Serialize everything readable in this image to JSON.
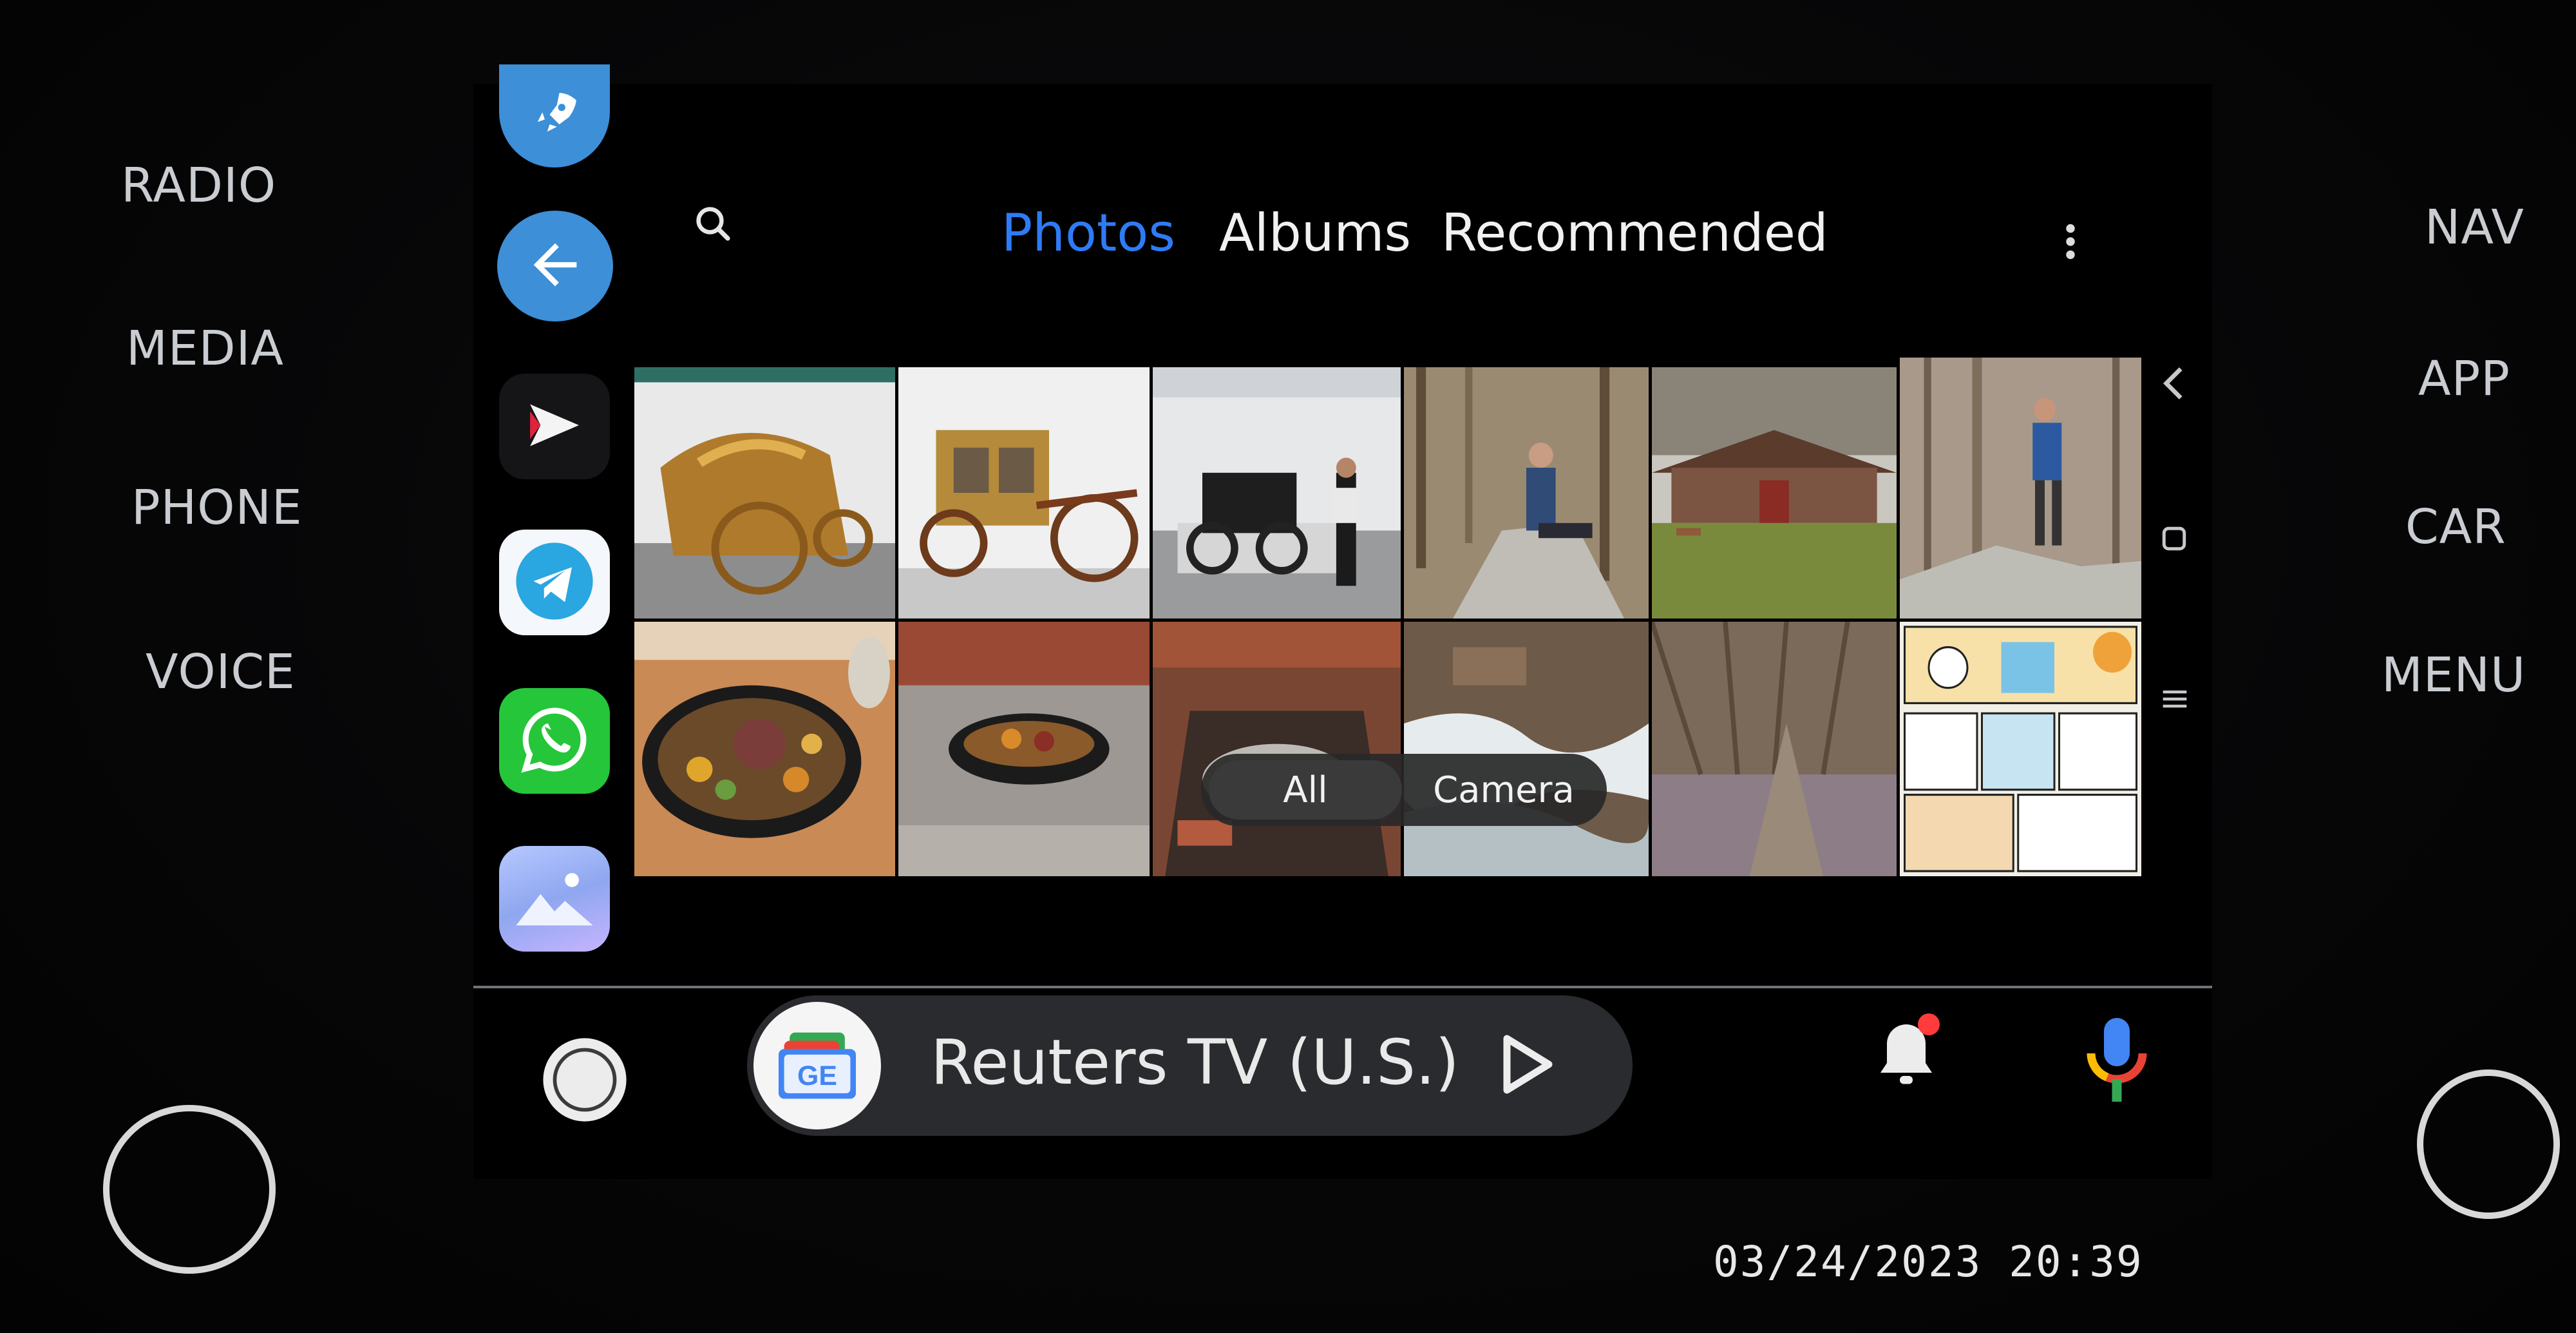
{
  "hard_keys": {
    "left": [
      "RADIO",
      "MEDIA",
      "PHONE",
      "VOICE"
    ],
    "right": [
      "NAV",
      "APP",
      "CAR",
      "MENU"
    ]
  },
  "dock": {
    "apps": [
      {
        "name": "launcher",
        "icon": "rocket-icon",
        "color": "#3d8fd8"
      },
      {
        "name": "back",
        "icon": "arrow-left-icon",
        "color": "#3d8fd8"
      },
      {
        "name": "media-player",
        "icon": "play-logo-icon",
        "color": "#1b1b1f"
      },
      {
        "name": "telegram",
        "icon": "telegram-icon",
        "color": "#2aa6e0"
      },
      {
        "name": "whatsapp",
        "icon": "whatsapp-icon",
        "color": "#25c63a"
      },
      {
        "name": "gallery",
        "icon": "gallery-icon",
        "color": "#8fb0f0"
      }
    ]
  },
  "header": {
    "tabs": [
      {
        "label": "Photos",
        "active": true
      },
      {
        "label": "Albums",
        "active": false
      },
      {
        "label": "Recommended",
        "active": false
      }
    ],
    "accent": "#2e7bf6"
  },
  "gallery": {
    "filter": {
      "options": [
        "All",
        "Camera"
      ],
      "selected": "All"
    }
  },
  "media_bar": {
    "title": "Reuters TV (U.S.)",
    "app_icon": "google-news-icon",
    "app_icon_text": "GE"
  },
  "status": {
    "notification_badge_color": "#ff3b3b"
  },
  "overlay": {
    "timestamp": "03/24/2023 20:39"
  }
}
